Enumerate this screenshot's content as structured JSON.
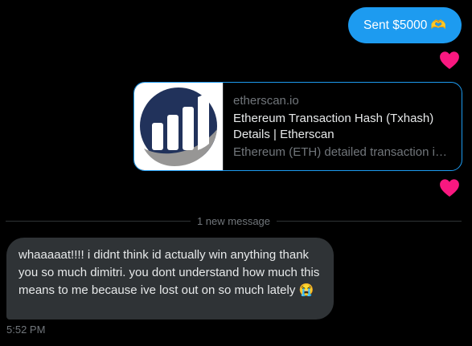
{
  "colors": {
    "background": "#000000",
    "sent_bubble": "#1d9bf0",
    "received_bubble": "#2f3336",
    "heart": "#f91880",
    "muted_text": "#71767b",
    "card_border": "#1d9bf0"
  },
  "messages": {
    "sent": {
      "text": "Sent $5000 🫶",
      "reaction_icon": "heart-icon"
    },
    "link_card": {
      "domain": "etherscan.io",
      "title": "Ethereum Transaction Hash (Txhash) Details | Etherscan",
      "description": "Ethereum (ETH) detailed transaction info for txhash",
      "thumbnail_icon": "etherscan-logo-icon",
      "reaction_icon": "heart-icon"
    },
    "divider_label": "1 new message",
    "received": {
      "text": "whaaaaat!!!! i didnt think id actually win anything thank you so much dimitri. you dont understand how much this means to me because ive lost out on so much lately 😭",
      "timestamp": "5:52 PM"
    }
  }
}
